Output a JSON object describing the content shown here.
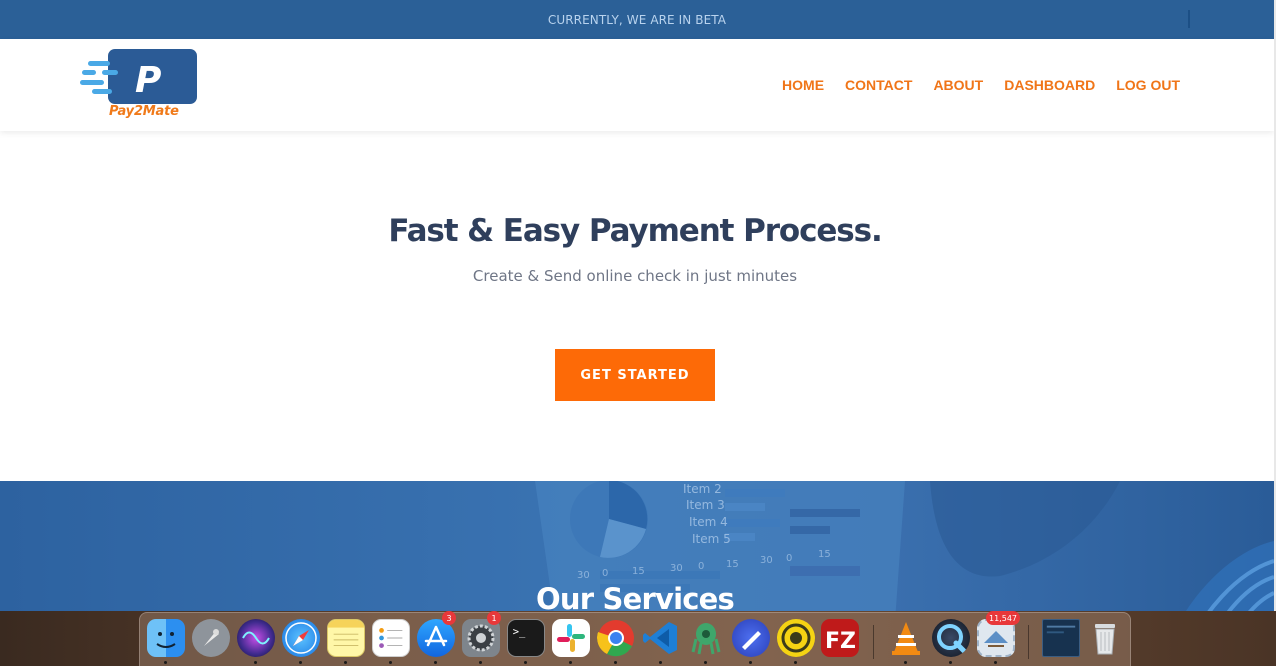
{
  "beta_bar": {
    "text": "CURRENTLY, WE ARE IN BETA"
  },
  "header": {
    "logo_letter": "P",
    "logo_text": "Pay2Mate",
    "nav": [
      {
        "label": "HOME"
      },
      {
        "label": "CONTACT"
      },
      {
        "label": "ABOUT"
      },
      {
        "label": "DASHBOARD"
      },
      {
        "label": "LOG OUT"
      }
    ]
  },
  "hero": {
    "title": "Fast & Easy Payment Process.",
    "subtitle": "Create & Send online check in just minutes",
    "cta_label": "GET STARTED"
  },
  "services": {
    "title": "Our Services",
    "bg_labels": [
      "Item 2",
      "Item 3",
      "Item 4",
      "Item 5"
    ],
    "bg_ticks": [
      "30",
      "0",
      "15",
      "30",
      "0",
      "15",
      "30",
      "0",
      "15"
    ]
  },
  "dock": {
    "items": [
      {
        "name": "finder-icon",
        "badge": ""
      },
      {
        "name": "launchpad-icon",
        "badge": ""
      },
      {
        "name": "siri-icon",
        "badge": ""
      },
      {
        "name": "safari-icon",
        "badge": ""
      },
      {
        "name": "notes-icon",
        "badge": ""
      },
      {
        "name": "reminders-icon",
        "badge": ""
      },
      {
        "name": "app-store-icon",
        "badge": "3"
      },
      {
        "name": "system-preferences-icon",
        "badge": "1"
      },
      {
        "name": "terminal-icon",
        "badge": ""
      },
      {
        "name": "slack-icon",
        "badge": ""
      },
      {
        "name": "chrome-icon",
        "badge": ""
      },
      {
        "name": "vscode-icon",
        "badge": ""
      },
      {
        "name": "gitkraken-icon",
        "badge": ""
      },
      {
        "name": "postman-icon",
        "badge": ""
      },
      {
        "name": "sequel-icon",
        "badge": ""
      },
      {
        "name": "filezilla-icon",
        "badge": ""
      },
      {
        "name": "vlc-icon",
        "badge": ""
      },
      {
        "name": "quicktime-icon",
        "badge": ""
      },
      {
        "name": "mail-icon",
        "badge": "11,547"
      },
      {
        "name": "window-icon",
        "badge": ""
      },
      {
        "name": "trash-icon",
        "badge": ""
      }
    ],
    "terminal_prompt": ">_",
    "filezilla_letters": "FZ",
    "colors": {
      "finder": "#3b9cf0",
      "safari": "#1e8cf0",
      "chrome_red": "#e33b2e",
      "vscode": "#1e7fd6",
      "vlc": "#f28a12",
      "filezilla": "#bf1a1a"
    }
  },
  "colors": {
    "beta_bar": "#2b6097",
    "accent": "#fd6a07",
    "nav": "#f07518",
    "heading": "#2f3f5c",
    "services_bg": "#2f65a3"
  }
}
